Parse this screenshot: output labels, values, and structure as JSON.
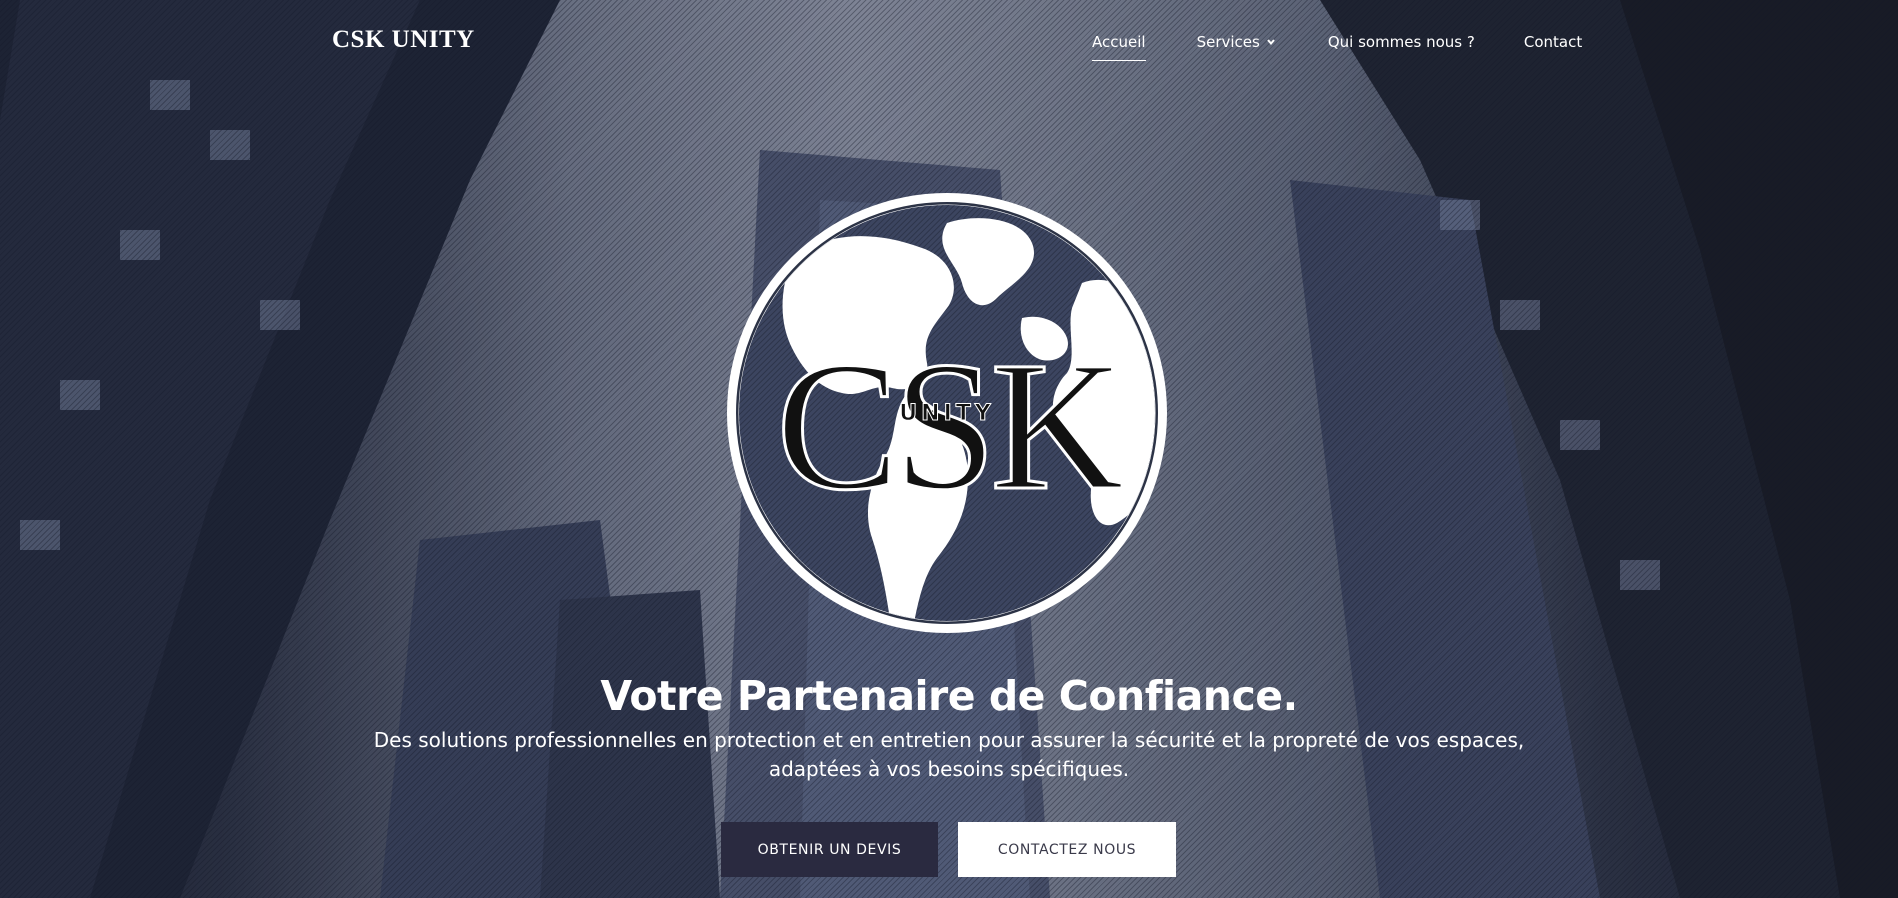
{
  "nav": {
    "brand": "CSK UNITY",
    "items": [
      {
        "label": "Accueil",
        "active": true
      },
      {
        "label": "Services",
        "has_dropdown": true,
        "icon": "chevron-down-icon"
      },
      {
        "label": "Qui sommes nous ?"
      },
      {
        "label": "Contact"
      }
    ]
  },
  "logo": {
    "letters": "CSK",
    "subword": "UNITY",
    "icon": "globe-icon"
  },
  "hero": {
    "headline": "Votre Partenaire de Confiance.",
    "subtext_lines": [
      "Des solutions professionnelles en protection et en entretien pour assurer la sécurité et la propreté de vos espaces,",
      "adaptées à vos besoins spécifiques."
    ]
  },
  "buttons": {
    "devis": "OBTENIR UN DEVIS",
    "contact": "CONTACTEZ NOUS"
  },
  "colors": {
    "primary_dark": "#2a2a40",
    "white": "#ffffff"
  }
}
